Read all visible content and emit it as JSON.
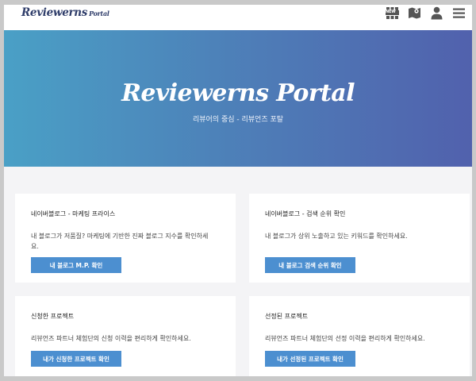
{
  "header": {
    "logo_main": "Reviewerns",
    "logo_sub": "Portal",
    "icons": [
      "new-grid-icon",
      "map-icon",
      "user-icon",
      "hamburger-menu-icon"
    ],
    "new_badge": "NEW"
  },
  "hero": {
    "title": "Reviewerns Portal",
    "subtitle": "리뷰어의 중심 - 리뷰언즈 포탈"
  },
  "cards": [
    {
      "title": "네이버블로그 - 마케팅 프라이스",
      "description": "내 블로그가 저품질? 마케팅에 기반한 진짜 블로그 지수를 확인하세요.",
      "button": "내 블로그 M.P. 확인"
    },
    {
      "title": "네이버블로그 - 검색 순위 확인",
      "description": "내 블로그가 상위 노출하고 있는 키워드를 확인하세요.",
      "button": "내 블로그 검색 순위 확인"
    },
    {
      "title": "신청한 프로젝트",
      "description": "리뷰언즈 파트너 체험단의 신청 이력을 편리하게 확인하세요.",
      "button": "내가 신청한 프로젝트 확인"
    },
    {
      "title": "선정된 프로젝트",
      "description": "리뷰언즈 파트너 체험단의 선정 이력을 편리하게 확인하세요.",
      "button": "내가 선정된 프로젝트 확인"
    }
  ],
  "colors": {
    "hero_start": "#4aa0c6",
    "hero_end": "#5161ad",
    "button": "#4c8fd0",
    "logo": "#2f3d6a",
    "icon": "#555555"
  }
}
